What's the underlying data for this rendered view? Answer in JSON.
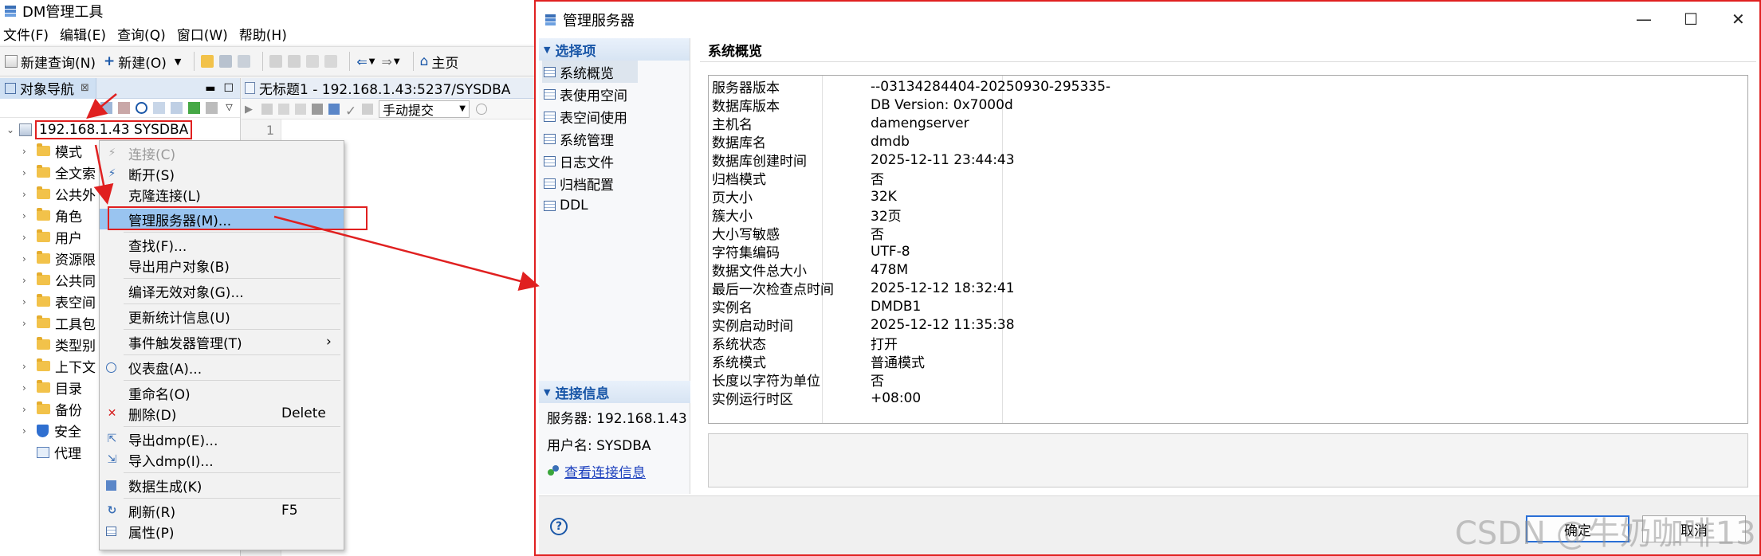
{
  "main_window": {
    "title": "DM管理工具",
    "menu": [
      "文件(F)",
      "编辑(E)",
      "查询(Q)",
      "窗口(W)",
      "帮助(H)"
    ],
    "toolbar": {
      "new_query": "新建查询(N)",
      "new": "新建(O)",
      "home": "主页"
    }
  },
  "navigator": {
    "tab_label": "对象导航",
    "tab_close": "⊠",
    "root_label": "192.168.1.43  SYSDBA",
    "items": [
      {
        "label": "模式"
      },
      {
        "label": "全文索"
      },
      {
        "label": "公共外"
      },
      {
        "label": "角色"
      },
      {
        "label": "用户"
      },
      {
        "label": "资源限"
      },
      {
        "label": "公共同"
      },
      {
        "label": "表空间"
      },
      {
        "label": "工具包"
      },
      {
        "label": "类型别"
      },
      {
        "label": "上下文"
      },
      {
        "label": "目录"
      },
      {
        "label": "备份"
      },
      {
        "label": "安全"
      },
      {
        "label": "代理"
      }
    ]
  },
  "editor": {
    "tab_label": "无标题1 - 192.168.1.43:5237/SYSDBA",
    "commit_mode": "手动提交",
    "line_number": "1"
  },
  "context_menu": {
    "items": [
      {
        "label": "连接(C)",
        "shortcut": ""
      },
      {
        "label": "断开(S)",
        "shortcut": ""
      },
      {
        "label": "克隆连接(L)",
        "shortcut": ""
      },
      {
        "label": "管理服务器(M)...",
        "shortcut": ""
      },
      {
        "label": "查找(F)...",
        "shortcut": ""
      },
      {
        "label": "导出用户对象(B)",
        "shortcut": ""
      },
      {
        "label": "编译无效对象(G)...",
        "shortcut": ""
      },
      {
        "label": "更新统计信息(U)",
        "shortcut": ""
      },
      {
        "label": "事件触发器管理(T)",
        "shortcut": "›"
      },
      {
        "label": "仪表盘(A)...",
        "shortcut": ""
      },
      {
        "label": "重命名(O)",
        "shortcut": ""
      },
      {
        "label": "删除(D)",
        "shortcut": "Delete"
      },
      {
        "label": "导出dmp(E)...",
        "shortcut": ""
      },
      {
        "label": "导入dmp(I)...",
        "shortcut": ""
      },
      {
        "label": "数据生成(K)",
        "shortcut": ""
      },
      {
        "label": "刷新(R)",
        "shortcut": "F5"
      },
      {
        "label": "属性(P)",
        "shortcut": ""
      }
    ]
  },
  "dialog": {
    "title": "管理服务器",
    "controls": {
      "minimize": "—",
      "maximize": "☐",
      "close": "✕"
    },
    "options_header": "选择项",
    "options": [
      "系统概览",
      "表使用空间",
      "表空间使用",
      "系统管理",
      "日志文件",
      "归档配置",
      "DDL"
    ],
    "connection_header": "连接信息",
    "server_line": "服务器: 192.168.1.43",
    "user_line": "用户名: SYSDBA",
    "view_conn_link": "查看连接信息",
    "overview_title": "系统概览",
    "properties": [
      {
        "key": "服务器版本",
        "value": "--03134284404-20250930-295335-"
      },
      {
        "key": "数据库版本",
        "value": "DB Version: 0x7000d"
      },
      {
        "key": "主机名",
        "value": "damengserver"
      },
      {
        "key": "数据库名",
        "value": "dmdb"
      },
      {
        "key": "数据库创建时间",
        "value": "2025-12-11 23:44:43"
      },
      {
        "key": "归档模式",
        "value": "否"
      },
      {
        "key": "页大小",
        "value": "32K"
      },
      {
        "key": "簇大小",
        "value": "32页"
      },
      {
        "key": "大小写敏感",
        "value": "否"
      },
      {
        "key": "字符集编码",
        "value": "UTF-8"
      },
      {
        "key": "数据文件总大小",
        "value": "478M"
      },
      {
        "key": "最后一次检查点时间",
        "value": "2025-12-12 18:32:41"
      },
      {
        "key": "实例名",
        "value": "DMDB1"
      },
      {
        "key": "实例启动时间",
        "value": "2025-12-12 11:35:38"
      },
      {
        "key": "系统状态",
        "value": "打开"
      },
      {
        "key": "系统模式",
        "value": "普通模式"
      },
      {
        "key": "长度以字符为单位",
        "value": "否"
      },
      {
        "key": "实例运行时区",
        "value": "+08:00"
      }
    ],
    "help": "?",
    "ok_label": "确定",
    "cancel_label": "取消"
  },
  "watermark": "CSDN @牛奶咖啡13",
  "colors": {
    "annotation_red": "#e02020",
    "selection_blue": "#99c4f0",
    "section_blue": "#1a57a8"
  }
}
